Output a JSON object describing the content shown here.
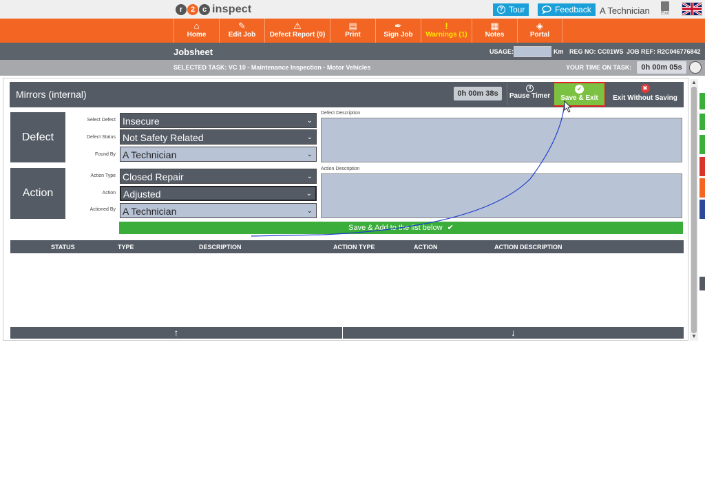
{
  "topbar": {
    "logo_r": "r",
    "logo_two": "2",
    "logo_c": "c",
    "logo_word": "inspect",
    "tour_label": "Tour",
    "feedback_label": "Feedback",
    "user_name": "A Technician",
    "exit_label": "Exit"
  },
  "nav": {
    "items": [
      {
        "label": "Home",
        "icon": "home-icon"
      },
      {
        "label": "Edit Job",
        "icon": "edit-job-icon"
      },
      {
        "label": "Defect Report (0)",
        "icon": "warning-triangle-icon"
      },
      {
        "label": "Print",
        "icon": "printer-icon"
      },
      {
        "label": "Sign Job",
        "icon": "pen-icon"
      },
      {
        "label": "Warnings (1)",
        "icon": "exclamation-icon"
      },
      {
        "label": "Notes",
        "icon": "notes-icon"
      },
      {
        "label": "Portal",
        "icon": "portal-icon"
      }
    ]
  },
  "jobbar": {
    "title": "Jobsheet",
    "usage_label": "USAGE:",
    "usage_unit": "Km",
    "reg_no": "REG NO: CC01WS",
    "job_ref": "JOB REF: R2C046776842"
  },
  "taskbar": {
    "selected_task": "SELECTED TASK: VC 10 - Maintenance Inspection - Motor Vehicles",
    "time_label": "YOUR TIME ON TASK:",
    "time_value": "0h 00m 05s"
  },
  "panel": {
    "title": "Mirrors (internal)",
    "elapsed": "0h 00m 38s",
    "pause_label": "Pause Timer",
    "save_exit_label": "Save & Exit",
    "exit_nosave_label": "Exit Without Saving"
  },
  "defect": {
    "block_label": "Defect",
    "select_defect_label": "Select Defect",
    "select_defect_value": "Insecure",
    "status_label": "Defect Status",
    "status_value": "Not Safety Related",
    "found_by_label": "Found By",
    "found_by_value": "A Technician",
    "description_label": "Defect Description",
    "description_value": ""
  },
  "action": {
    "block_label": "Action",
    "type_label": "Action Type",
    "type_value": "Closed Repair",
    "action_label": "Action",
    "action_value": "Adjusted",
    "actioned_by_label": "Actioned By",
    "actioned_by_value": "A Technician",
    "description_label": "Action Description",
    "description_value": ""
  },
  "save_add_label": "Save & Add to the list below",
  "table": {
    "headers": [
      "STATUS",
      "TYPE",
      "DESCRIPTION",
      "ACTION TYPE",
      "ACTION",
      "ACTION DESCRIPTION"
    ],
    "rows": []
  },
  "colors": {
    "brand_orange": "#f26522",
    "header_grey": "#545b65",
    "save_green": "#7bc142",
    "highlight_red": "#e02020",
    "tour_blue": "#1a9fd8"
  }
}
